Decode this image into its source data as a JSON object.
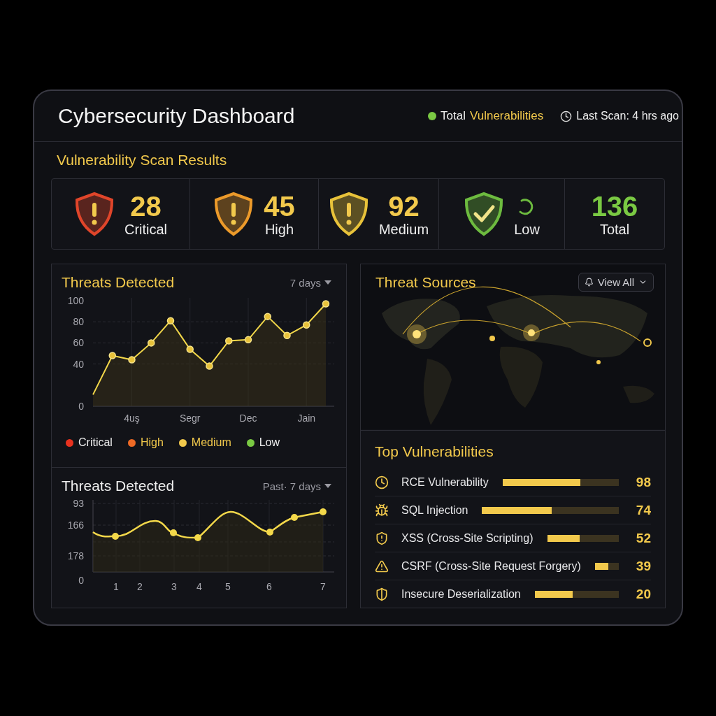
{
  "window": {
    "title": "Cybersecurity Dashboard"
  },
  "header": {
    "status": {
      "label": "Total",
      "highlight": "Vulnerabilities",
      "color": "#7ac943"
    },
    "last_scan": "Last Scan: 4 hrs ago"
  },
  "scan_results": {
    "title": "Vulnerability Scan Results",
    "items": [
      {
        "kind": "alert",
        "value": "28",
        "label": "Critical",
        "color": "#e0452a"
      },
      {
        "kind": "alert",
        "value": "45",
        "label": "High",
        "color": "#ec9a2a"
      },
      {
        "kind": "alert",
        "value": "92",
        "label": "Medium",
        "color": "#e8c23a"
      },
      {
        "kind": "check",
        "label": "Low",
        "color": "#6dbb3f",
        "loading": true
      },
      {
        "kind": "total",
        "value": "136",
        "label": "Total",
        "color": "#7ac943"
      }
    ]
  },
  "threats_chart": {
    "period": "7 days",
    "chart_data": {
      "type": "area",
      "title": "Threats Detected",
      "grid": true,
      "marker": "o",
      "categories": [
        null,
        null,
        "4uş",
        null,
        null,
        "Segr",
        null,
        null,
        "Dec",
        null,
        null,
        "Jain",
        null
      ],
      "values": [
        11,
        48,
        44,
        60,
        81,
        54,
        38,
        62,
        63,
        85,
        67,
        77,
        97
      ],
      "ylim": [
        0,
        100
      ],
      "yticks": [
        100,
        80,
        60,
        40,
        0
      ]
    },
    "legend": [
      {
        "label": "Critical",
        "color": "#e8321f",
        "highlighted": false
      },
      {
        "label": "High",
        "color": "#ef6a25",
        "highlighted": true
      },
      {
        "label": "Medium",
        "color": "#f2c94c",
        "highlighted": true
      },
      {
        "label": "Low",
        "color": "#7ac943",
        "highlighted": false
      }
    ]
  },
  "threats_daily": {
    "title": "Threats Detected",
    "period": "Past· 7 days",
    "y_ticks": [
      "93",
      "166",
      "178",
      "0"
    ],
    "x_ticks": [
      "1",
      "2",
      "3",
      "4",
      "5",
      "6",
      "7"
    ]
  },
  "threat_sources": {
    "title": "Threat Sources",
    "button": "View All"
  },
  "top_vulnerabilities": {
    "title": "Top Vulnerabilities",
    "items": [
      {
        "name": "RCE Vulnerability",
        "level": 0.67,
        "score": "98"
      },
      {
        "name": "SQL Injection",
        "level": 0.51,
        "score": "74"
      },
      {
        "name": "XSS (Cross-Site Scripting)",
        "level": 0.45,
        "score": "52"
      },
      {
        "name": "CSRF (Cross-Site Request Forgery)",
        "level": 0.56,
        "score": "39"
      },
      {
        "name": "Insecure Deserialization",
        "level": 0.45,
        "score": "20"
      }
    ]
  }
}
